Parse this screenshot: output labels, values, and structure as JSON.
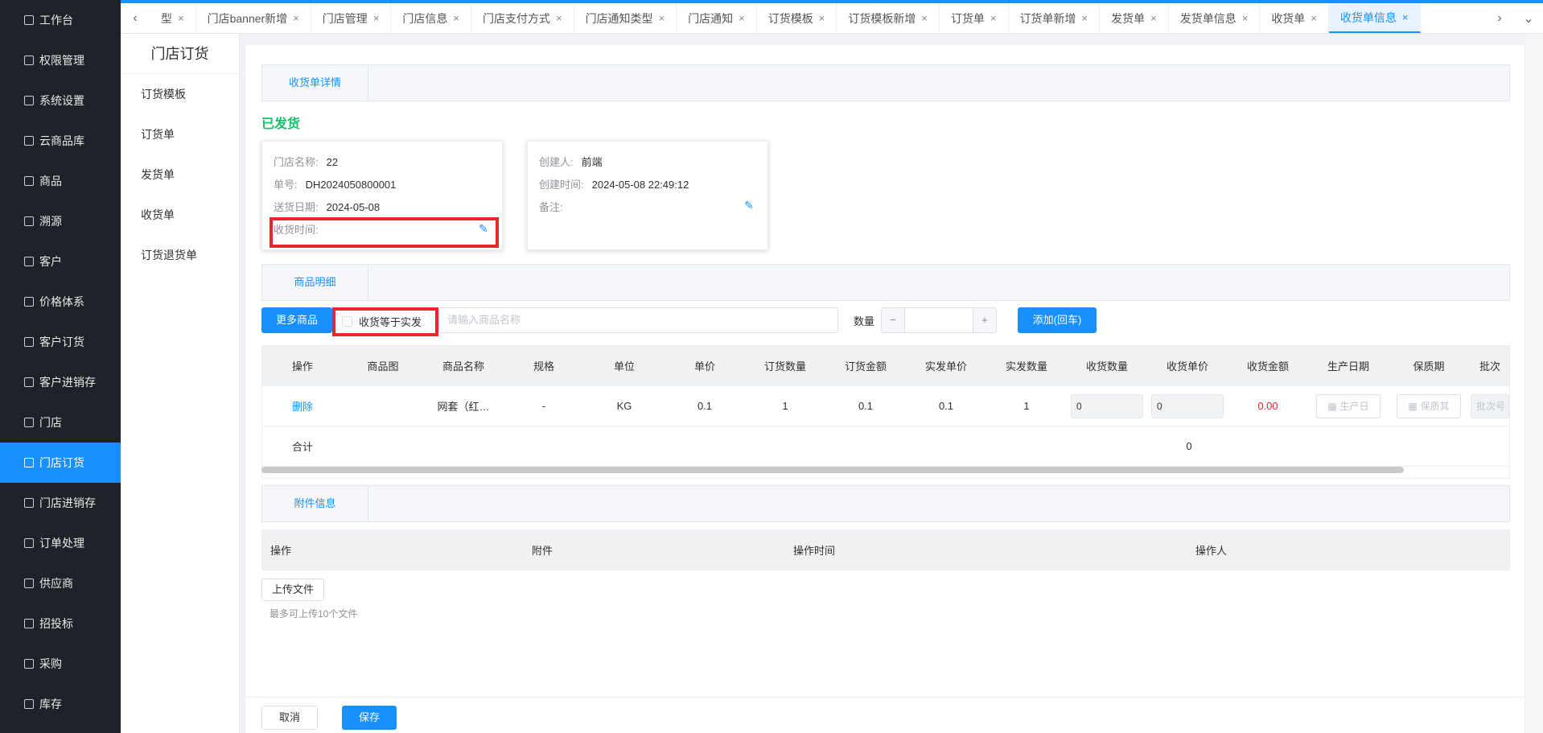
{
  "colors": {
    "accent": "#1890ff",
    "sidebar_bg": "#1f2329",
    "success": "#19be6b",
    "danger": "#e8262c"
  },
  "sidebar": {
    "items": [
      {
        "label": "工作台",
        "icon": "monitor-icon"
      },
      {
        "label": "权限管理",
        "icon": "shield-icon"
      },
      {
        "label": "系统设置",
        "icon": "gear-icon"
      },
      {
        "label": "云商品库",
        "icon": "cloud-upload-icon"
      },
      {
        "label": "商品",
        "icon": "box-icon"
      },
      {
        "label": "溯源",
        "icon": "trace-icon"
      },
      {
        "label": "客户",
        "icon": "user-icon"
      },
      {
        "label": "价格体系",
        "icon": "price-icon"
      },
      {
        "label": "客户订货",
        "icon": "order-icon"
      },
      {
        "label": "客户进销存",
        "icon": "bank-icon"
      },
      {
        "label": "门店",
        "icon": "store-icon"
      },
      {
        "label": "门店订货",
        "icon": "store-order-icon",
        "active": true
      },
      {
        "label": "门店进销存",
        "icon": "inventory-icon"
      },
      {
        "label": "订单处理",
        "icon": "send-icon"
      },
      {
        "label": "供应商",
        "icon": "supplier-icon"
      },
      {
        "label": "招投标",
        "icon": "bid-icon"
      },
      {
        "label": "采购",
        "icon": "purchase-icon"
      },
      {
        "label": "库存",
        "icon": "stock-icon"
      }
    ]
  },
  "tabs": {
    "left_arrow": "‹",
    "right_arrow": "›",
    "more": "⌄",
    "items": [
      {
        "label": "型"
      },
      {
        "label": "门店banner新增"
      },
      {
        "label": "门店管理"
      },
      {
        "label": "门店信息"
      },
      {
        "label": "门店支付方式"
      },
      {
        "label": "门店通知类型"
      },
      {
        "label": "门店通知"
      },
      {
        "label": "订货模板"
      },
      {
        "label": "订货模板新增"
      },
      {
        "label": "订货单"
      },
      {
        "label": "订货单新增"
      },
      {
        "label": "发货单"
      },
      {
        "label": "发货单信息"
      },
      {
        "label": "收货单"
      },
      {
        "label": "收货单信息",
        "active": true
      }
    ],
    "close": "×"
  },
  "submenu": {
    "title": "门店订货",
    "items": [
      "订货模板",
      "订货单",
      "发货单",
      "收货单",
      "订货退货单"
    ]
  },
  "detail": {
    "section_title": "收货单详情",
    "status": "已发货",
    "card1": {
      "store_label": "门店名称:",
      "store_value": "22",
      "no_label": "单号:",
      "no_value": "DH2024050800001",
      "date_label": "送货日期:",
      "date_value": "2024-05-08",
      "recv_label": "收货时间:",
      "recv_value": ""
    },
    "card2": {
      "creator_label": "创建人:",
      "creator_value": "前端",
      "ctime_label": "创建时间:",
      "ctime_value": "2024-05-08 22:49:12",
      "remark_label": "备注:",
      "remark_value": ""
    }
  },
  "goods": {
    "section_title": "商品明细",
    "more_button": "更多商品",
    "checkbox_label": "收货等于实发",
    "search_placeholder": "请输入商品名称",
    "qty_label": "数量",
    "minus": "−",
    "plus": "+",
    "add_button": "添加(回车)",
    "columns": [
      "操作",
      "商品图",
      "商品名称",
      "规格",
      "单位",
      "单价",
      "订货数量",
      "订货金额",
      "实发单价",
      "实发数量",
      "收货数量",
      "收货单价",
      "收货金额",
      "生产日期",
      "保质期",
      "批次"
    ],
    "rows": [
      {
        "action": "删除",
        "image": "",
        "name": "网套（红…",
        "spec": "-",
        "unit": "KG",
        "price": "0.1",
        "order_qty": "1",
        "order_amount": "0.1",
        "ship_price": "0.1",
        "ship_qty": "1",
        "recv_qty": "0",
        "recv_price": "0",
        "recv_amount": "0.00",
        "prod_date": "生产日",
        "shelf_life": "保质其",
        "batch": "批次号"
      }
    ],
    "total_label": "合计",
    "total_value": "0"
  },
  "attachments": {
    "section_title": "附件信息",
    "columns": [
      "操作",
      "附件",
      "操作时间",
      "操作人"
    ],
    "upload_button": "上传文件",
    "hint": "最多可上传10个文件"
  },
  "footer": {
    "cancel": "取消",
    "save": "保存"
  }
}
